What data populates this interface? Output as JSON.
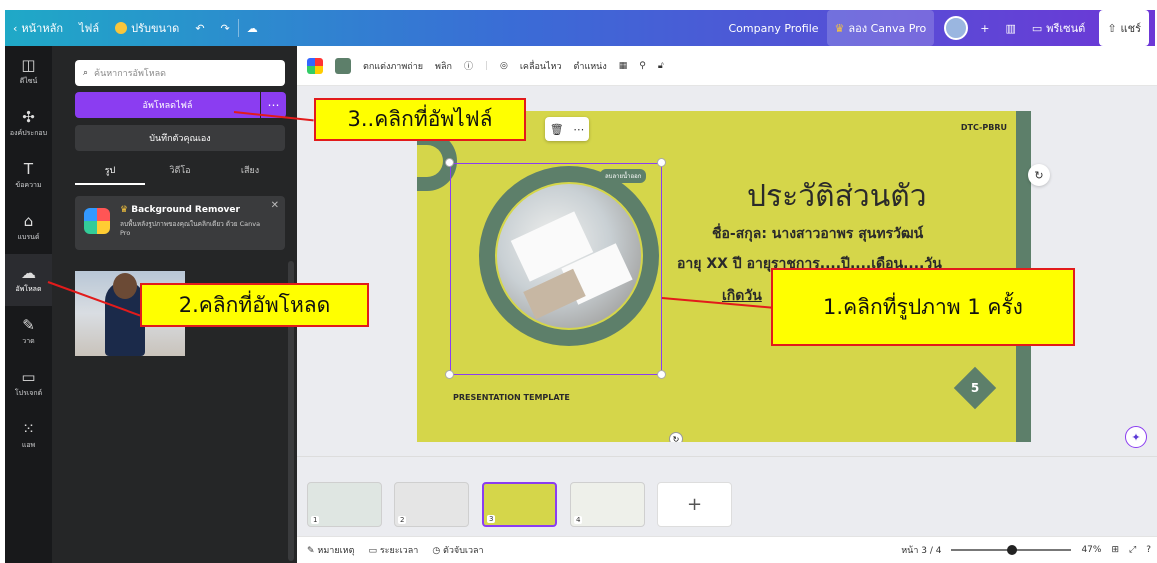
{
  "topbar": {
    "back_label": "หน้าหลัก",
    "file_label": "ไฟล์",
    "resize_label": "ปรับขนาด",
    "project_name": "Company Profile",
    "try_pro_label": "ลอง Canva Pro",
    "present_label": "พรีเซนต์",
    "share_label": "แชร์"
  },
  "rail": {
    "items": [
      {
        "label": "ดีไซน์",
        "icon": "layout-icon"
      },
      {
        "label": "องค์ประกอบ",
        "icon": "elements-icon"
      },
      {
        "label": "ข้อความ",
        "icon": "text-icon"
      },
      {
        "label": "แบรนด์",
        "icon": "brand-icon"
      },
      {
        "label": "อัพโหลด",
        "icon": "upload-cloud-icon"
      },
      {
        "label": "วาด",
        "icon": "draw-icon"
      },
      {
        "label": "โปรเจกต์",
        "icon": "folder-icon"
      },
      {
        "label": "แอพ",
        "icon": "apps-grid-icon"
      }
    ]
  },
  "panel": {
    "search_placeholder": "ค้นหาการอัพโหลด",
    "upload_button": "อัพโหลดไฟล์",
    "record_button": "บันทึกตัวคุณเอง",
    "tabs": [
      "รูป",
      "วิดีโอ",
      "เสียง"
    ],
    "promo": {
      "title": "Background Remover",
      "desc": "ลบพื้นหลังรูปภาพของคุณในคลิกเดียว ด้วย Canva Pro"
    }
  },
  "toolbar": {
    "edit_photo": "ตกแต่งภาพถ่าย",
    "flip": "พลิก",
    "animate": "เคลื่อนไหว",
    "position": "ตำแหน่ง"
  },
  "slide": {
    "brand": "DTC-PBRU",
    "title": "ประวัติส่วนตัว",
    "line1": "ชื่อ-สกุล: นางสาวอาพร สุนทรวัฒน์",
    "line2": "อายุ  XX  ปี อายุราชการ....ปี....เดือน....วัน",
    "line3": "เกิดวัน",
    "tag": "ลบลายน้ำออก",
    "footer": "PRESENTATION TEMPLATE",
    "page_number": "5"
  },
  "filmstrip": {
    "pages": [
      "1",
      "2",
      "3",
      "4"
    ],
    "selected": 3
  },
  "bottombar": {
    "notes": "หมายเหตุ",
    "duration": "ระยะเวลา",
    "timer": "ตัวจับเวลา",
    "page_indicator": "หน้า 3 / 4",
    "zoom": "47%"
  },
  "annotations": {
    "step1": "1.คลิกที่รูปภาพ 1 ครั้ง",
    "step2": "2.คลิกที่อัพโหลด",
    "step3": "3..คลิกที่อัพไฟล์"
  },
  "colors": {
    "accent_purple": "#8b3df1",
    "slide_yellow": "#d5d64a",
    "slide_green": "#5d7f6a",
    "callout_yellow": "#ffff00",
    "callout_red": "#e21b1b"
  }
}
